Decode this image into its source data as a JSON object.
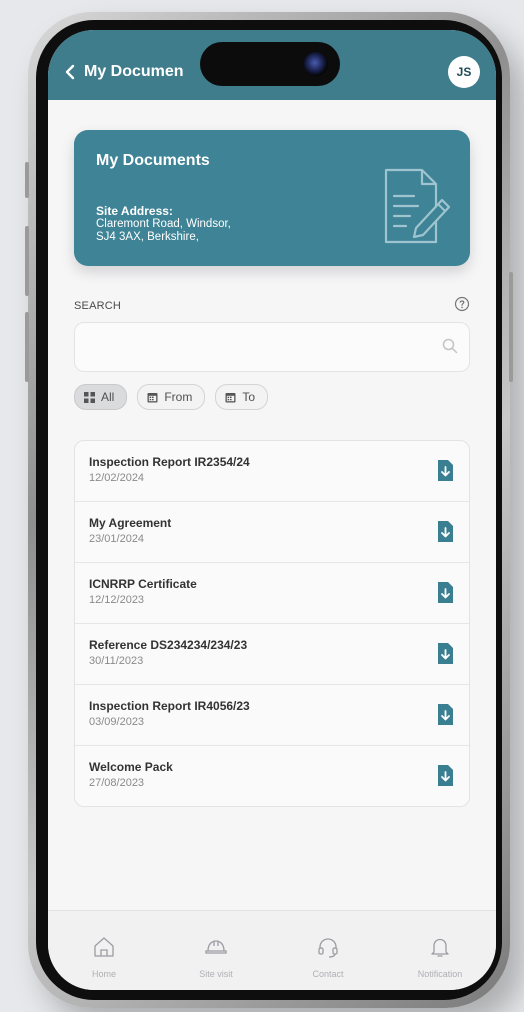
{
  "header": {
    "back_title": "My Documen",
    "avatar_initials": "JS",
    "bar_color": "#3f7d8c"
  },
  "hero": {
    "title": "My Documents",
    "site_label": "Site Address:",
    "address_line1": "Claremont Road, Windsor,",
    "address_line2": "SJ4 3AX, Berkshire,",
    "icon": "document-pen-icon",
    "color": "#3f8396"
  },
  "search": {
    "label": "SEARCH",
    "value": "",
    "placeholder": ""
  },
  "filters": [
    {
      "label": "All",
      "icon": "grid-icon",
      "active": true
    },
    {
      "label": "From",
      "icon": "calendar-icon",
      "active": false
    },
    {
      "label": "To",
      "icon": "calendar-icon",
      "active": false
    }
  ],
  "documents": [
    {
      "title": "Inspection Report IR2354/24",
      "date": "12/02/2024"
    },
    {
      "title": "My Agreement",
      "date": "23/01/2024"
    },
    {
      "title": "ICNRRP Certificate",
      "date": "12/12/2023"
    },
    {
      "title": "Reference DS234234/234/23",
      "date": "30/11/2023"
    },
    {
      "title": "Inspection Report IR4056/23",
      "date": "03/09/2023"
    },
    {
      "title": "Welcome Pack",
      "date": "27/08/2023"
    }
  ],
  "nav": [
    {
      "label": "Home",
      "icon": "home-icon"
    },
    {
      "label": "Site visit",
      "icon": "hard-hat-icon"
    },
    {
      "label": "Contact",
      "icon": "headset-icon"
    },
    {
      "label": "Notification",
      "icon": "bell-icon"
    }
  ],
  "colors": {
    "accent": "#3f7d8c",
    "download_icon": "#3a7f91"
  }
}
